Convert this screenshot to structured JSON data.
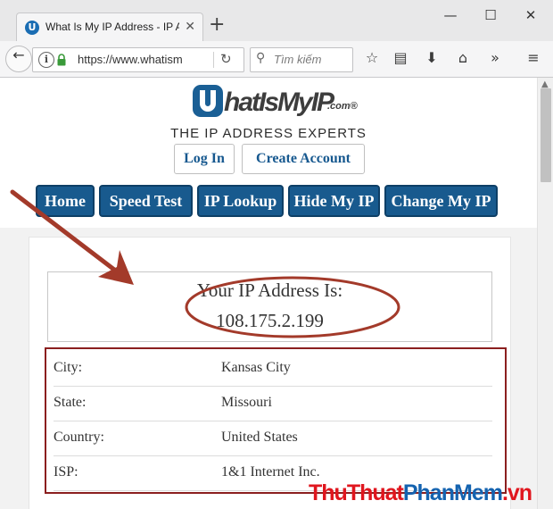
{
  "browser": {
    "tab_title": "What Is My IP Address - IP A",
    "tab_favicon_letter": "U",
    "url": "https://www.whatism",
    "search_placeholder": "Tìm kiếm",
    "icons": [
      "back-arrow-icon",
      "info-icon",
      "lock-icon",
      "reload-icon",
      "search-icon",
      "bookmark-star-icon",
      "reading-list-icon",
      "download-icon",
      "home-icon",
      "overflow-chevron-icon",
      "hamburger-menu-icon",
      "minimize-icon",
      "maximize-icon",
      "close-icon",
      "new-tab-plus-icon"
    ]
  },
  "site": {
    "logo": {
      "text": "hatIsMyIP",
      "suffix": ".com®"
    },
    "tagline": "THE IP ADDRESS EXPERTS",
    "auth": {
      "login": "Log In",
      "create_account": "Create Account"
    },
    "nav": [
      "Home",
      "Speed Test",
      "IP Lookup",
      "Hide My IP",
      "Change My IP"
    ]
  },
  "ip": {
    "label": "Your IP Address Is:",
    "value": "108.175.2.199"
  },
  "details": [
    {
      "label": "City:",
      "value": "Kansas City"
    },
    {
      "label": "State:",
      "value": "Missouri"
    },
    {
      "label": "Country:",
      "value": "United States"
    },
    {
      "label": "ISP:",
      "value": "1&1 Internet Inc."
    }
  ],
  "watermark": {
    "part1": "ThuThuat",
    "part2": "PhanMem",
    "part3": ".vn"
  },
  "colors": {
    "nav_blue": "#185a8e",
    "annotation_red": "#a33a2a",
    "details_border": "#8b1f1f"
  }
}
